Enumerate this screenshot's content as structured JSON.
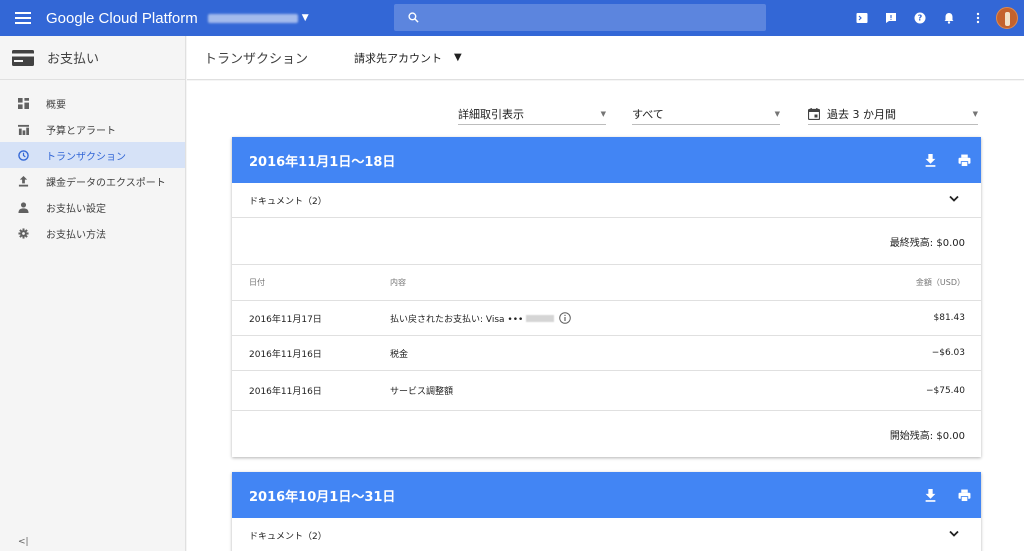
{
  "topbar": {
    "brand": "Google Cloud Platform",
    "search_placeholder": "",
    "icons": [
      "cloud-shell-icon",
      "feedback-icon",
      "help-icon",
      "notifications-icon",
      "more-vert-icon"
    ],
    "colors": {
      "bar": "#3367d6",
      "search": "#5c85de"
    }
  },
  "sidebar": {
    "title": "お支払い",
    "items": [
      {
        "label": "概要",
        "icon": "dashboard-icon"
      },
      {
        "label": "予算とアラート",
        "icon": "budget-icon"
      },
      {
        "label": "トランザクション",
        "icon": "clock-icon",
        "active": true
      },
      {
        "label": "課金データのエクスポート",
        "icon": "export-icon"
      },
      {
        "label": "お支払い設定",
        "icon": "person-icon"
      },
      {
        "label": "お支払い方法",
        "icon": "gear-icon"
      }
    ],
    "collapse_label": "<|"
  },
  "header": {
    "title": "トランザクション",
    "billing_account": "請求先アカウント"
  },
  "filters": {
    "detail": "詳細取引表示",
    "type": "すべて",
    "period": "過去 3 か月間"
  },
  "statements": [
    {
      "period": "2016年11月1日〜18日",
      "documents": "ドキュメント（2）",
      "closing": "最終残高: $0.00",
      "columns": {
        "date": "日付",
        "desc": "内容",
        "amount": "金額（USD）"
      },
      "rows": [
        {
          "date": "2016年11月17日",
          "desc": "払い戻されたお支払い: Visa •••",
          "amount": "$81.43",
          "info": true
        },
        {
          "date": "2016年11月16日",
          "desc": "税金",
          "amount": "−$6.03"
        },
        {
          "date": "2016年11月16日",
          "desc": "サービス調整額",
          "amount": "−$75.40"
        }
      ],
      "opening": "開始残高: $0.00"
    },
    {
      "period": "2016年10月1日〜31日",
      "documents": "ドキュメント（2）"
    }
  ],
  "colors": {
    "card_header": "#4285f4",
    "active_nav": "#d6e2f7"
  }
}
